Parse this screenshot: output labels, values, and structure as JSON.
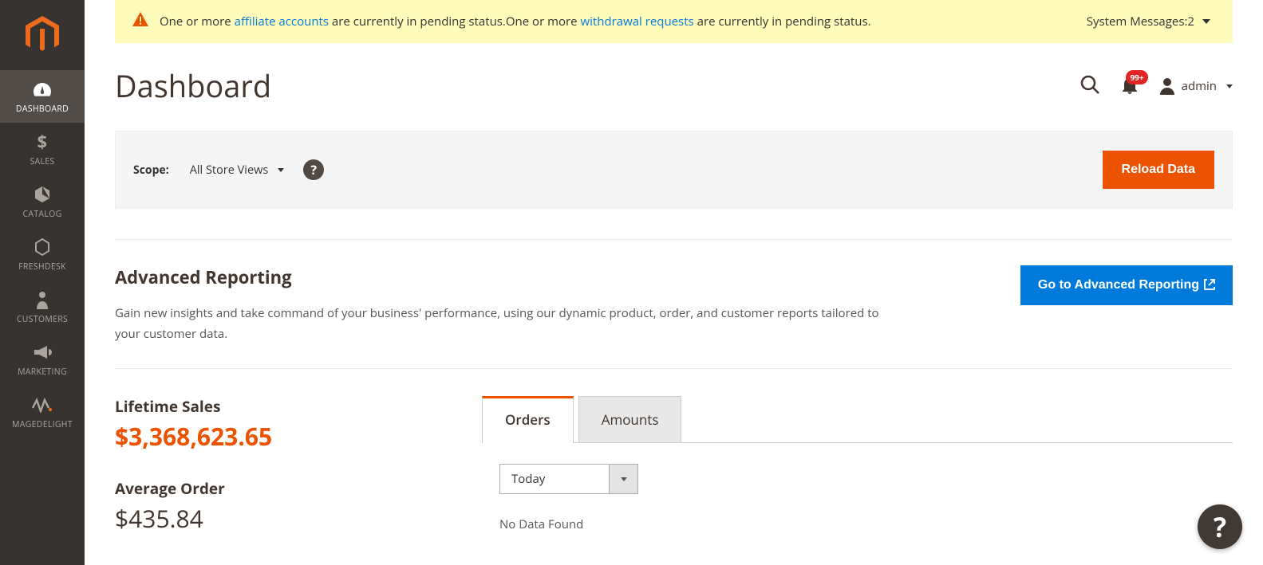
{
  "sidebar": {
    "items": [
      {
        "id": "dashboard",
        "label": "DASHBOARD",
        "icon": "gauge"
      },
      {
        "id": "sales",
        "label": "SALES",
        "icon": "dollar"
      },
      {
        "id": "catalog",
        "label": "CATALOG",
        "icon": "cube"
      },
      {
        "id": "freshdesk",
        "label": "FRESHDESK",
        "icon": "hex"
      },
      {
        "id": "customers",
        "label": "CUSTOMERS",
        "icon": "person"
      },
      {
        "id": "marketing",
        "label": "MARKETING",
        "icon": "bullhorn"
      },
      {
        "id": "magedelight",
        "label": "MAGEDELIGHT",
        "icon": "pulse"
      }
    ],
    "active_id": "dashboard"
  },
  "system_messages": {
    "text_prefix": "One or more ",
    "link1": "affiliate accounts",
    "text_mid1": " are currently in pending status.One or more ",
    "link2": "withdrawal requests",
    "text_suffix": " are currently in pending status.",
    "right_label": "System Messages: ",
    "count": "2"
  },
  "header": {
    "title": "Dashboard",
    "notification_badge": "99+",
    "user_name": "admin"
  },
  "scope": {
    "label": "Scope:",
    "selected": "All Store Views",
    "reload_label": "Reload Data"
  },
  "advanced_reporting": {
    "title": "Advanced Reporting",
    "description": "Gain new insights and take command of your business' performance, using our dynamic product, order, and customer reports tailored to your customer data.",
    "button_label": "Go to Advanced Reporting"
  },
  "stats": {
    "lifetime_sales": {
      "title": "Lifetime Sales",
      "value": "$3,368,623.65"
    },
    "average_order": {
      "title": "Average Order",
      "value": "$435.84"
    }
  },
  "tabs": {
    "items": [
      {
        "id": "orders",
        "label": "Orders"
      },
      {
        "id": "amounts",
        "label": "Amounts"
      }
    ],
    "active_id": "orders",
    "period_selected": "Today",
    "no_data_text": "No Data Found"
  },
  "colors": {
    "accent_orange": "#eb5202",
    "accent_blue": "#007bdb",
    "sysmsg_bg": "#fffbbb",
    "sidebar_bg": "#373330"
  }
}
